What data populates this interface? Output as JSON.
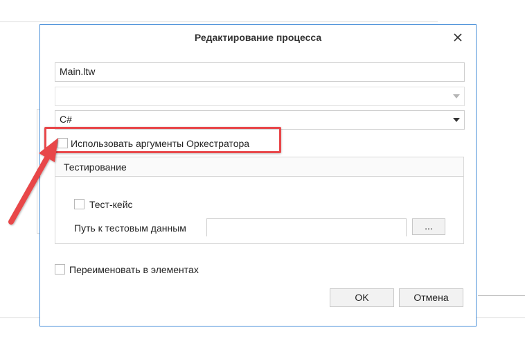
{
  "dialog": {
    "title": "Редактирование процесса",
    "close_icon": "close-icon"
  },
  "form": {
    "name_value": "Main.ltw",
    "empty_select_value": "",
    "language_value": "C#",
    "use_orchestrator_args_label": "Использовать аргументы Оркестратора",
    "rename_in_elements_label": "Переименовать в элементах"
  },
  "testing": {
    "header": "Тестирование",
    "test_case_label": "Тест-кейс",
    "test_data_path_label": "Путь к тестовым данным",
    "test_data_path_value": "",
    "browse_label": "..."
  },
  "buttons": {
    "ok": "OK",
    "cancel": "Отмена"
  },
  "colors": {
    "dialog_border": "#4a90d9",
    "annotation_red": "#e8474a"
  }
}
